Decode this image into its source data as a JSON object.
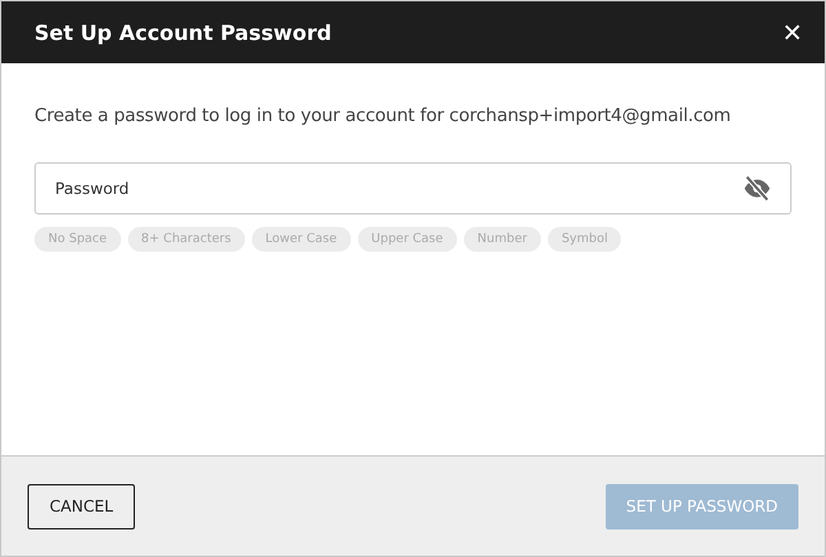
{
  "dialog": {
    "title": "Set Up Account Password",
    "close": "✕"
  },
  "message": "Create a password to log in to your account for corchansp+import4@gmail.com",
  "password_field": {
    "placeholder": "Password",
    "visible": false
  },
  "requirements": [
    {
      "label": "No Space",
      "met": false
    },
    {
      "label": "8+ Characters",
      "met": false
    },
    {
      "label": "Lower Case",
      "met": false
    },
    {
      "label": "Upper Case",
      "met": false
    },
    {
      "label": "Number",
      "met": false
    },
    {
      "label": "Symbol",
      "met": false
    }
  ],
  "buttons": {
    "cancel": {
      "label": "CANCEL"
    },
    "submit": {
      "label": "SET UP PASSWORD",
      "disabled": true
    }
  }
}
